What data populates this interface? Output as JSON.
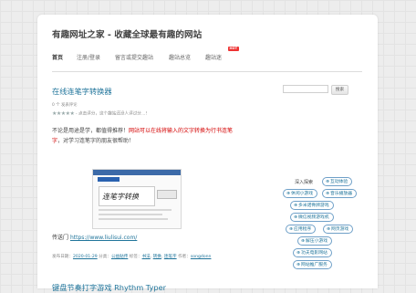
{
  "site": {
    "title": "有趣网址之家 - 收藏全球最有趣的网站"
  },
  "nav": {
    "items": [
      "首页",
      "注册/登录",
      "留言或提交趣站",
      "趣站总览",
      "趣站迷"
    ],
    "hot_badge": "HOT"
  },
  "post": {
    "title": "在线连笔字转换器",
    "comments": "0 个  发表评论",
    "rating_label": "- 点击评分，这个趣站还没人评过分…!",
    "stars": "★★★★★",
    "intro_before": "不论是用途是学，都值得推荐！",
    "intro_highlight": "网站可以在线将输入的文字转换为行书连笔字",
    "intro_after": "，对学习连笔字的朋友很帮助！",
    "shot_sample": "连笔字转换",
    "link_label": "传送门",
    "link_url": "https://www.liulisui.com/",
    "meta": {
      "prefix": "发布日期：",
      "date": "2020-01-29",
      "category_label": " 分类：",
      "category": "公益贴传",
      "tags_label": " 标签：",
      "tags": [
        "书法",
        "转换",
        "连笔字"
      ],
      "author_label": " 作者：",
      "author": "songdonn"
    }
  },
  "next_post": {
    "title": "键盘节奏打字游戏 Rhythm Typer"
  },
  "sidebar": {
    "search_placeholder": "",
    "search_button": "搜索",
    "section_label": "深入探索",
    "tags": [
      "互动体验",
      "休闲小游戏",
      "音乐播放器",
      "多米诺骨牌游戏",
      "微信视频游戏机",
      "应用程序",
      "网页游戏",
      "解压小游戏",
      "功夫电影网站",
      "网站推广服务"
    ]
  },
  "colors": {
    "link": "#21759b",
    "highlight": "#d40000",
    "hot": "#e33333"
  }
}
